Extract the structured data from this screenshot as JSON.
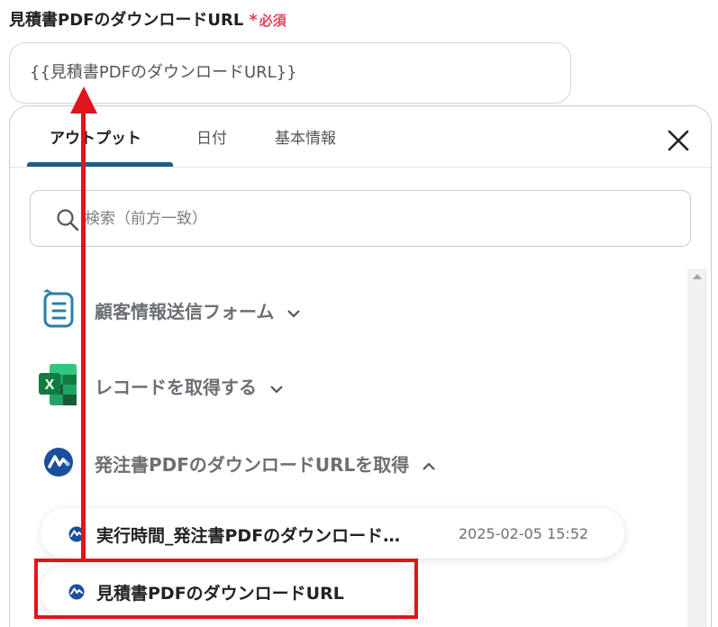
{
  "field": {
    "label": "見積書PDFのダウンロードURL",
    "required_mark": "*",
    "required_text": "必須",
    "value": "{{見積書PDFのダウンロードURL}}"
  },
  "panel": {
    "tabs": [
      {
        "label": "アウトプット",
        "active": true
      },
      {
        "label": "日付",
        "active": false
      },
      {
        "label": "基本情報",
        "active": false
      }
    ],
    "search": {
      "placeholder": "検索（前方一致）",
      "value": ""
    },
    "groups": [
      {
        "label": "顧客情報送信フォーム",
        "icon": "form-icon",
        "expanded": false
      },
      {
        "label": "レコードを取得する",
        "icon": "excel-icon",
        "expanded": false
      },
      {
        "label": "発注書PDFのダウンロードURLを取得",
        "icon": "app-logo-icon",
        "expanded": true
      }
    ],
    "items": [
      {
        "label": "実行時間_発注書PDFのダウンロード…",
        "time": "2025-02-05 15:52",
        "icon": "app-logo-icon"
      },
      {
        "label": "見積書PDFのダウンロードURL",
        "time": "",
        "icon": "app-logo-icon"
      }
    ]
  },
  "colors": {
    "accent": "#1b5e85",
    "required": "#e8405a",
    "annotation": "#e0141e"
  }
}
